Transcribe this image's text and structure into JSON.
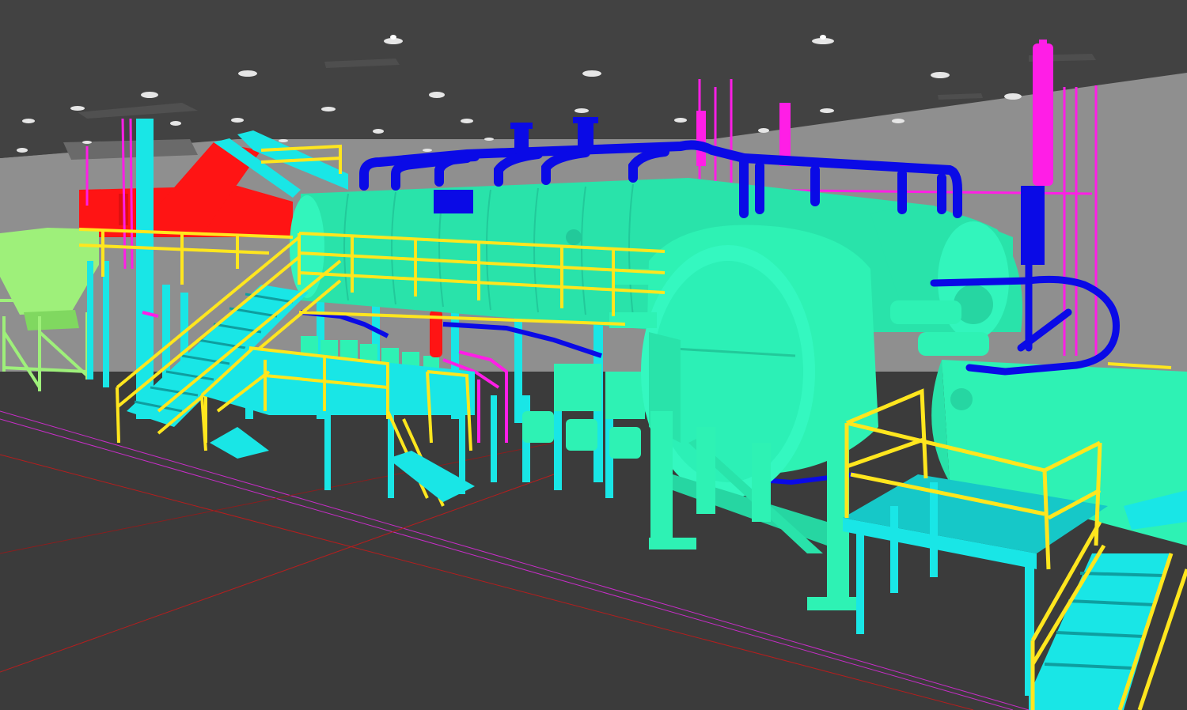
{
  "scene": {
    "kind": "3D plant model viewport",
    "background_color": "#3c3c3c",
    "ceiling_color": "#414141",
    "wall_color": "#8f8f8f",
    "floor_color": "#3a3a3a"
  },
  "layers": [
    {
      "name": "vessels",
      "color": "#2ef2b4"
    },
    {
      "name": "structure",
      "color": "#19e6e6"
    },
    {
      "name": "handrails",
      "color": "#ffe61e"
    },
    {
      "name": "process-piping",
      "color": "#0a0ae6"
    },
    {
      "name": "utility-piping",
      "color": "#ff1ee6"
    },
    {
      "name": "conveyor-housing",
      "color": "#ff1414"
    },
    {
      "name": "hopper",
      "color": "#9ef07a"
    },
    {
      "name": "floor-gridlines",
      "color": "#b41e1e"
    }
  ],
  "icons": [
    "ceiling-light-icon"
  ]
}
